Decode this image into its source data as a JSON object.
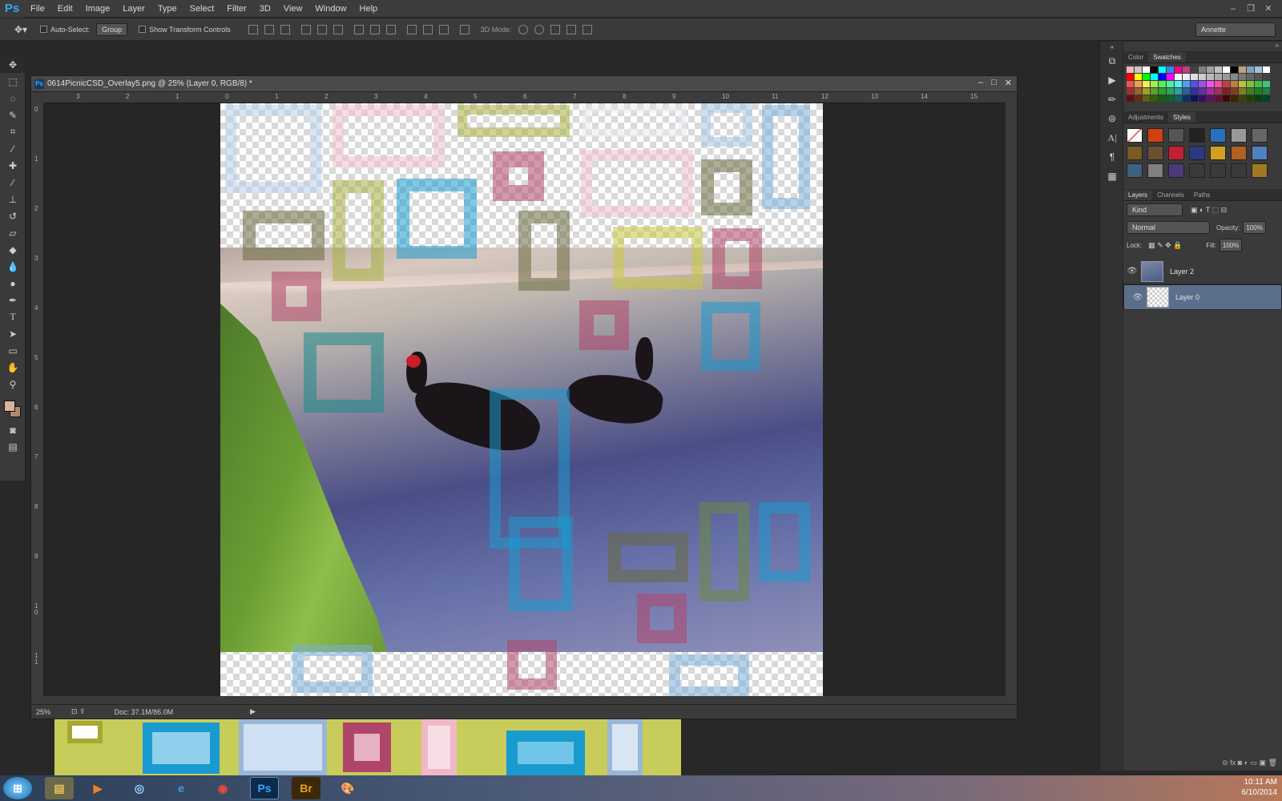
{
  "menubar": {
    "logo": "Ps",
    "items": [
      "File",
      "Edit",
      "Image",
      "Layer",
      "Type",
      "Select",
      "Filter",
      "3D",
      "View",
      "Window",
      "Help"
    ]
  },
  "options": {
    "auto_select_label": "Auto-Select:",
    "auto_select_value": "Group",
    "show_transform_label": "Show Transform Controls",
    "mode_3d_label": "3D Mode:",
    "workspace": "Annette"
  },
  "document": {
    "title": "0614PicnicCSD_Overlay5.png @ 25% (Layer 0, RGB/8) *",
    "zoom": "25%",
    "doc_size": "Doc: 37.1M/86.0M",
    "h_ruler": [
      "3",
      "2",
      "1",
      "0",
      "1",
      "2",
      "3",
      "4",
      "5",
      "6",
      "7",
      "8",
      "9",
      "10",
      "11",
      "12",
      "13",
      "14",
      "15"
    ],
    "v_ruler": [
      "0",
      "1",
      "2",
      "3",
      "4",
      "5",
      "6",
      "7",
      "8",
      "9",
      "1\n0",
      "1\n1"
    ]
  },
  "panels": {
    "color_tabs": [
      "Color",
      "Swatches"
    ],
    "adj_tabs": [
      "Adjustments",
      "Styles"
    ],
    "layer_tabs": [
      "Layers",
      "Channels",
      "Paths"
    ],
    "kind": "Kind",
    "blend_mode": "Normal",
    "opacity_label": "Opacity:",
    "opacity_value": "100%",
    "lock_label": "Lock:",
    "fill_label": "Fill:",
    "fill_value": "100%",
    "layers": [
      {
        "name": "Layer 2",
        "selected": false
      },
      {
        "name": "Layer 0",
        "selected": true
      }
    ]
  },
  "taskbar": {
    "time": "10:11 AM",
    "date": "6/10/2014",
    "apps": [
      "Ps",
      "Br"
    ]
  },
  "colors": {
    "accent": "#31a8ff",
    "selected_layer": "#5b6e8c",
    "foreground_swatch": "#d9b49c"
  }
}
